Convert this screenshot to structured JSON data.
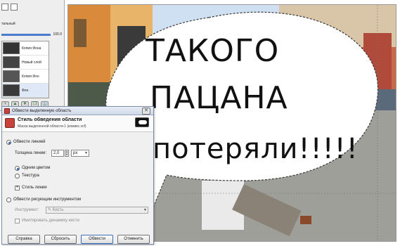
{
  "speech_bubble": {
    "line1": "ТАКОГО",
    "line2": "ПАЦАНА",
    "line3": "потеряли!!!!!"
  },
  "layers_panel": {
    "mode_label": "тальный",
    "opacity_value": "100.0",
    "opacity_fraction": 1.0,
    "layers": [
      {
        "name": "Копия Фона"
      },
      {
        "name": "Новый слой"
      },
      {
        "name": "Копия Фон"
      },
      {
        "name": "Фон"
      }
    ],
    "icons": [
      "new-layer-icon",
      "raise-layer-icon",
      "lower-layer-icon",
      "duplicate-layer-icon",
      "anchor-icon"
    ]
  },
  "dialog": {
    "window_title": "Обвести выделенную область",
    "header_title": "Стиль обведения области",
    "header_subtitle": "Маска выделенной области-1 (комикс.xcf)",
    "stroke_line_label": "Обвести линией",
    "line_width_label": "Толщина линии:",
    "line_width_value": "2,0",
    "unit_value": "px",
    "solid_color_label": "Одним цветом",
    "pattern_label": "Текстура",
    "line_style_label": "Стиль линии",
    "paint_tool_label": "Обвести рисующим инструментом",
    "tool_label": "Инструмент:",
    "tool_value": "Кисть",
    "emulate_label": "Имитировать динамику кисти",
    "buttons": {
      "help": "Справка",
      "reset": "Сбросить",
      "stroke": "Обвести",
      "cancel": "Отменить"
    }
  }
}
